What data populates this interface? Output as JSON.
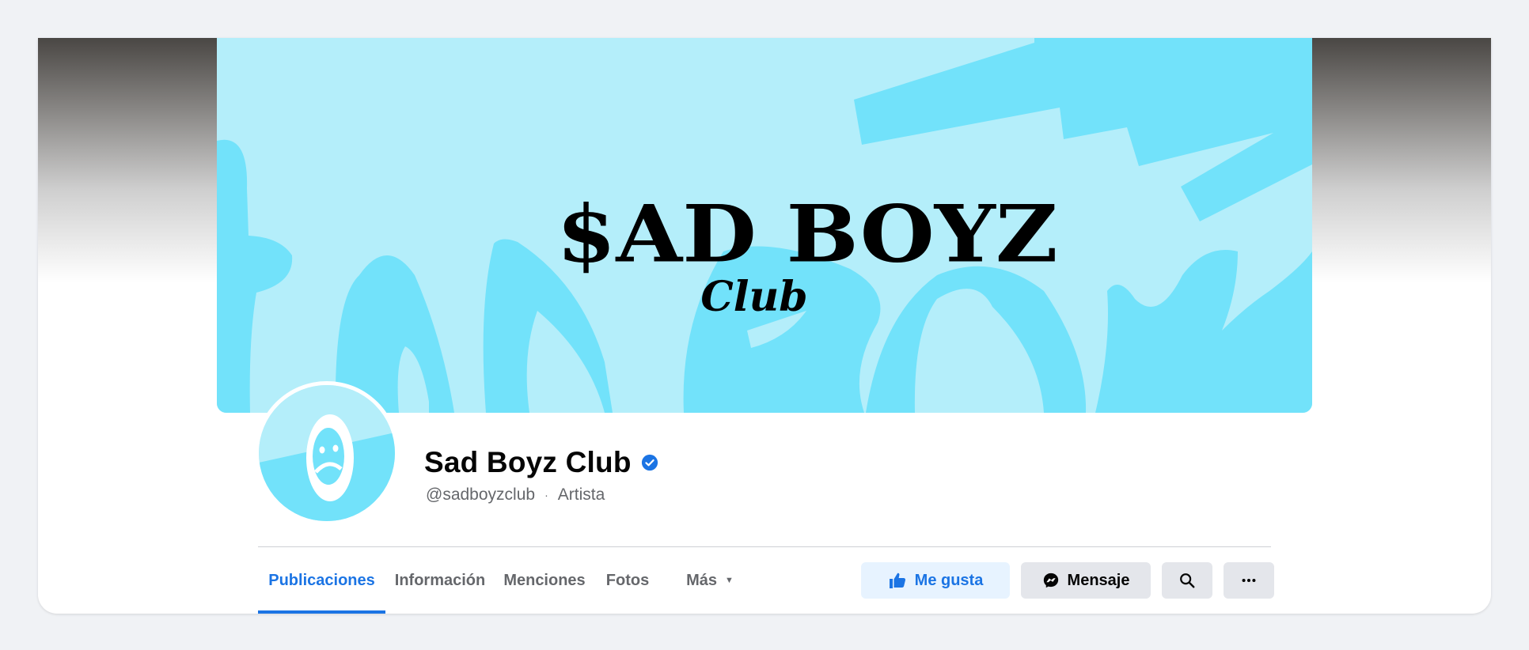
{
  "page": {
    "name": "Sad Boyz Club",
    "handle": "@sadboyzclub",
    "separator": "·",
    "category": "Artista",
    "verified": true
  },
  "cover": {
    "title_text": "$AD BOYZ",
    "subtitle_text": "Club",
    "colors": {
      "background": "#b4eefa",
      "shapes": "#72e2fa",
      "logo": "#000000"
    }
  },
  "tabs": [
    {
      "label": "Publicaciones",
      "active": true
    },
    {
      "label": "Información"
    },
    {
      "label": "Menciones"
    },
    {
      "label": "Fotos"
    },
    {
      "label": "Más",
      "icon": "caret-down-icon"
    }
  ],
  "actions": {
    "like": {
      "label": "Me gusta",
      "icon": "thumbs-up-icon"
    },
    "message": {
      "label": "Mensaje",
      "icon": "messenger-icon"
    },
    "search": {
      "icon": "search-icon"
    },
    "more": {
      "icon": "more-horizontal-icon"
    }
  },
  "colors": {
    "accent": "#1b74e4",
    "verified": "#1b74e4",
    "text": "#050505",
    "secondary": "#65676b"
  }
}
